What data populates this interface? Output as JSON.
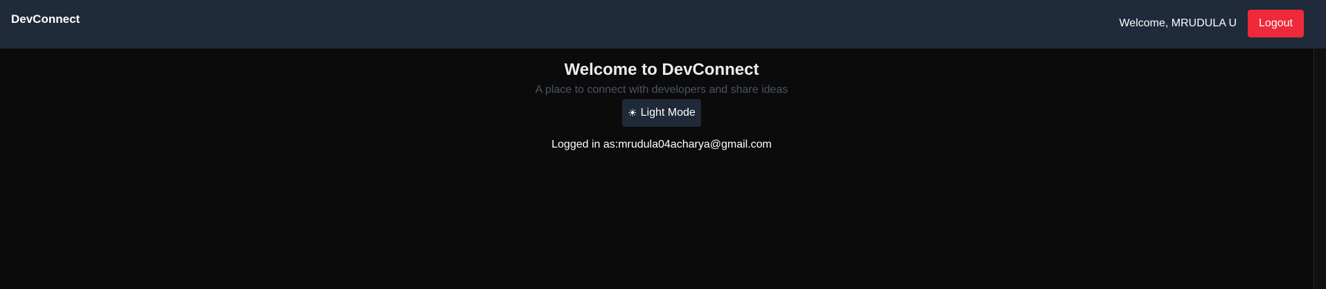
{
  "navbar": {
    "brand": "DevConnect",
    "welcome_text": "Welcome, MRUDULA U",
    "logout_label": "Logout"
  },
  "main": {
    "title": "Welcome to DevConnect",
    "subtitle": "A place to connect with developers and share ideas",
    "mode_button": {
      "icon": "sun-icon",
      "glyph": "☀",
      "label": "Light Mode"
    },
    "logged_in_text": "Logged in as:mrudula04acharya@gmail.com"
  },
  "colors": {
    "navbar_bg": "#1f2a3b",
    "page_bg": "#0b0b0b",
    "logout_bg": "#f0293a",
    "mode_button_bg": "#1f2937"
  }
}
